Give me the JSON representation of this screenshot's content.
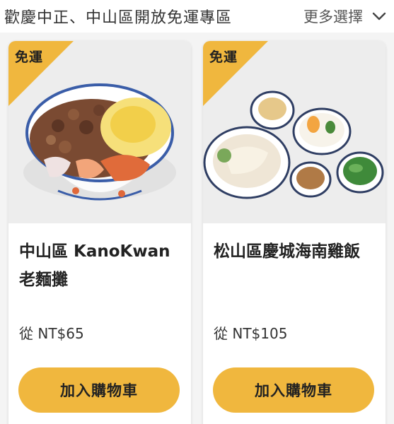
{
  "header": {
    "title": "歡慶中正、中山區開放免運專區",
    "more_label": "更多選擇"
  },
  "icons": {
    "more": "chevron-down-icon"
  },
  "colors": {
    "accent": "#f0b73e",
    "page_background": "#f4f4f4"
  },
  "products": [
    {
      "badge": "免運",
      "name": "中山區 KanoKwan 老麵攤",
      "price": "從 NT$65",
      "cart_label": "加入購物車"
    },
    {
      "badge": "免運",
      "name": "松山區慶城海南雞飯",
      "price": "從 NT$105",
      "cart_label": "加入購物車"
    }
  ]
}
